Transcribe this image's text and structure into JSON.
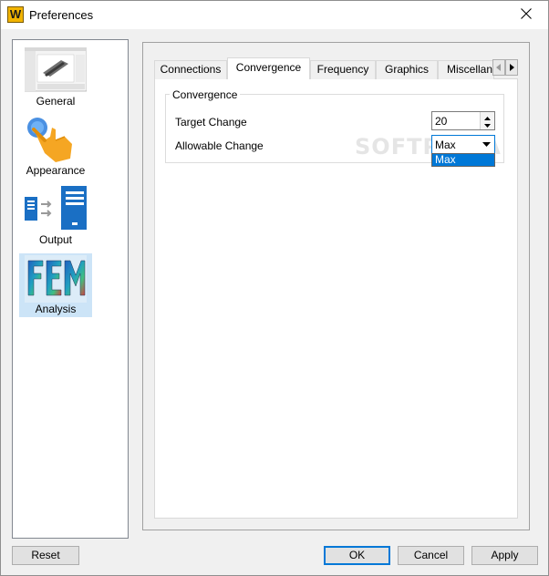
{
  "window": {
    "app_icon_letter": "W",
    "title": "Preferences"
  },
  "nav": {
    "items": [
      {
        "label": "General",
        "icon": "general-screenshot-icon",
        "selected": false
      },
      {
        "label": "Appearance",
        "icon": "pointing-hand-icon",
        "selected": false
      },
      {
        "label": "Output",
        "icon": "output-document-icon",
        "selected": false
      },
      {
        "label": "Analysis",
        "icon": "fem-analysis-icon",
        "selected": true
      }
    ]
  },
  "tabs": {
    "items": [
      {
        "label": "Connections",
        "active": false
      },
      {
        "label": "Convergence",
        "active": true
      },
      {
        "label": "Frequency",
        "active": false
      },
      {
        "label": "Graphics",
        "active": false
      },
      {
        "label": "Miscellane",
        "active": false
      }
    ]
  },
  "convergence": {
    "group_title": "Convergence",
    "target_change_label": "Target Change",
    "target_change_value": "20",
    "allowable_change_label": "Allowable Change",
    "allowable_change_value": "Max",
    "dropdown_options": [
      "Max"
    ]
  },
  "watermark": "SOFTPEDIA",
  "buttons": {
    "reset": "Reset",
    "ok": "OK",
    "cancel": "Cancel",
    "apply": "Apply"
  },
  "colors": {
    "accent": "#0078d7",
    "selected_bg": "#cce4f7",
    "app_icon": "#f2b400"
  }
}
